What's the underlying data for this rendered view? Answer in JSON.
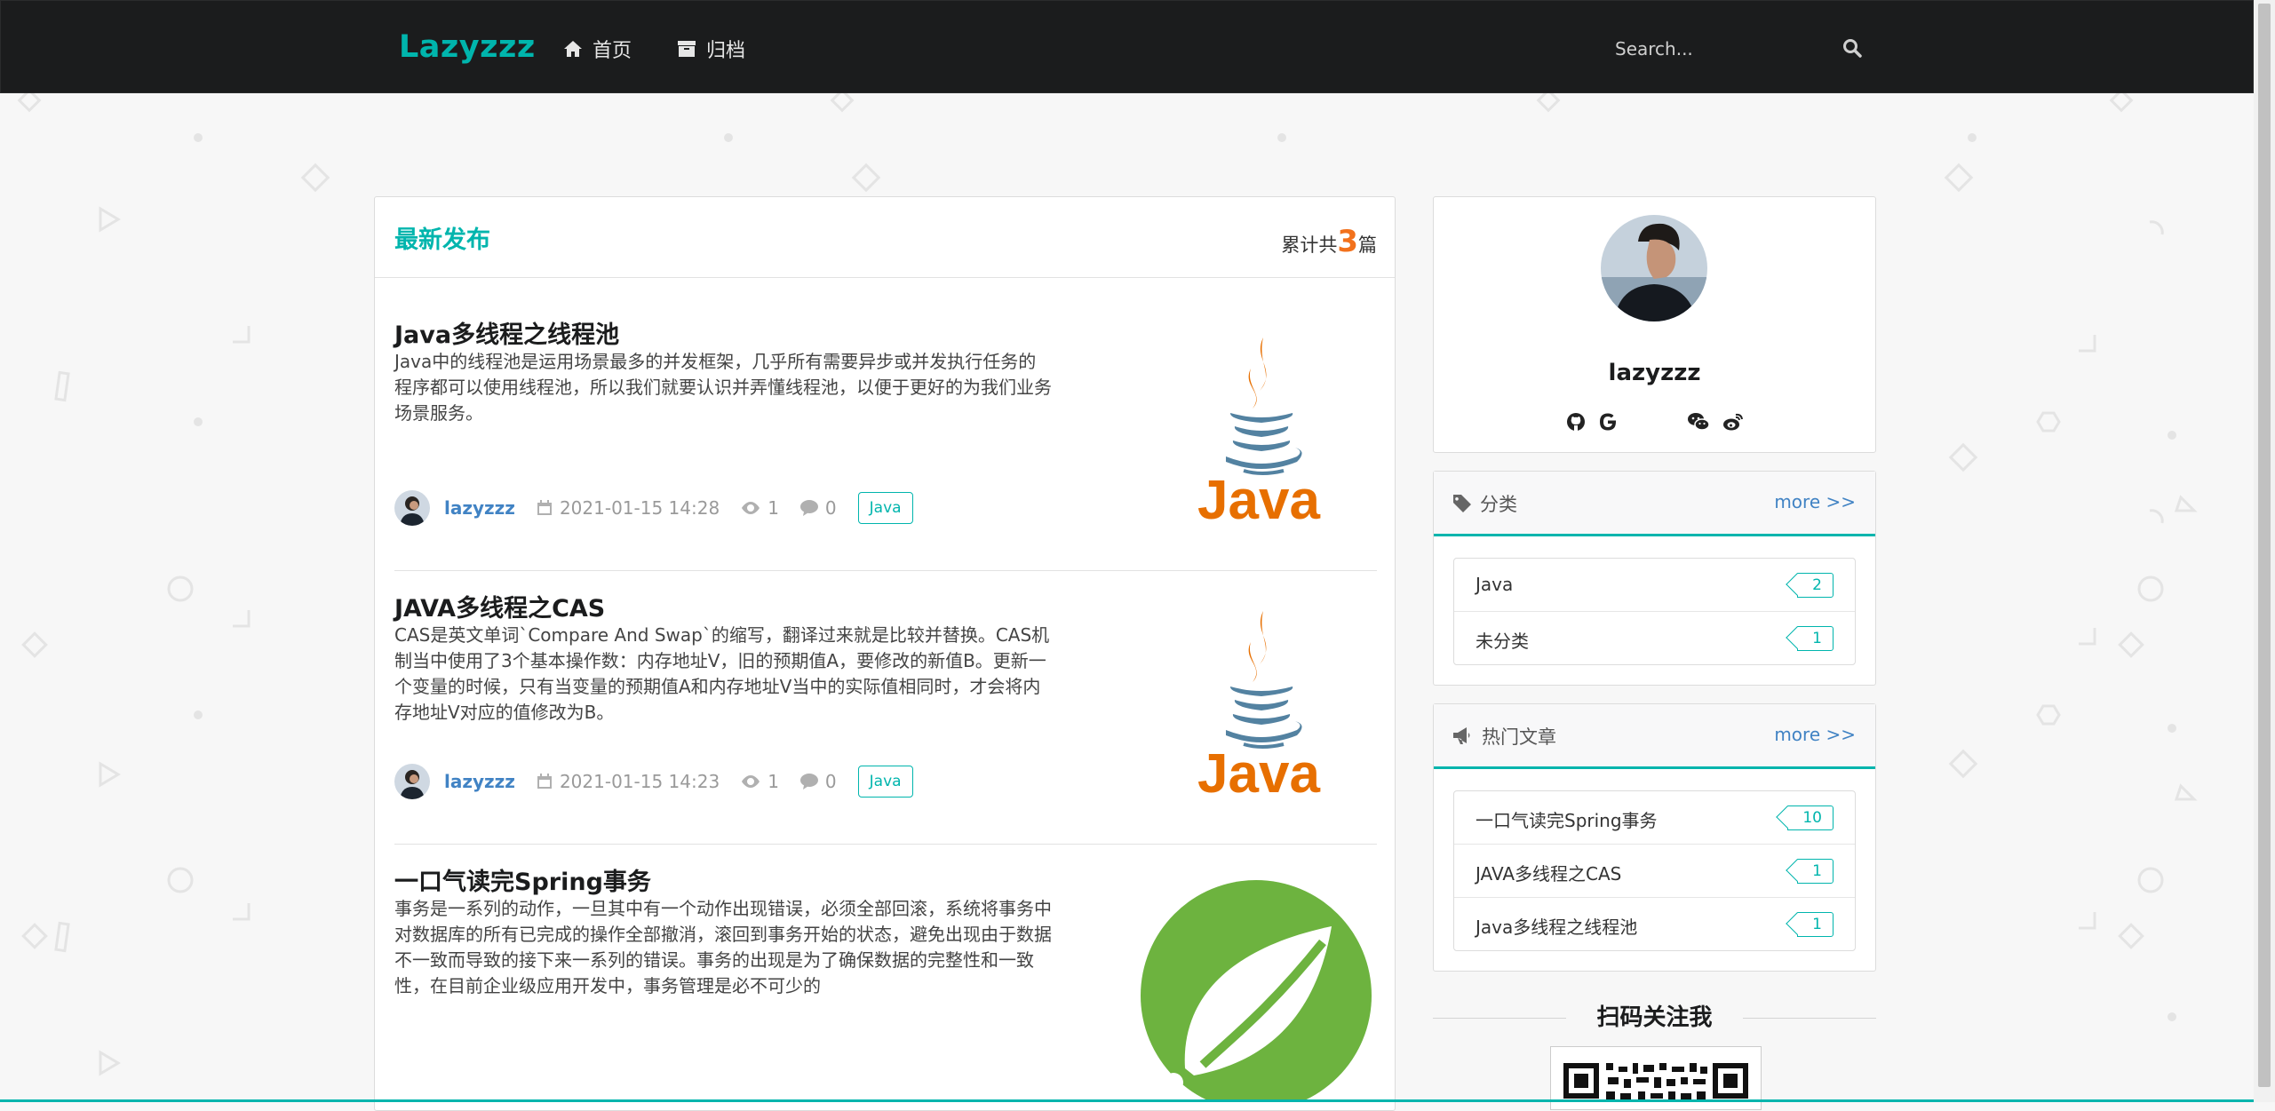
{
  "nav": {
    "brand": "Lazyzzz",
    "items": [
      {
        "label": "首页",
        "icon": "home-icon"
      },
      {
        "label": "归档",
        "icon": "archive-icon"
      }
    ],
    "search_placeholder": "Search..."
  },
  "main": {
    "title": "最新发布",
    "count_prefix": "累计共",
    "count": "3",
    "count_suffix": "篇",
    "posts": [
      {
        "title": "Java多线程之线程池",
        "excerpt": "Java中的线程池是运用场景最多的并发框架，几乎所有需要异步或并发执行任务的程序都可以使用线程池，所以我们就要认识并弄懂线程池，以便于更好的为我们业务场景服务。",
        "author": "lazyzzz",
        "date": "2021-01-15 14:28",
        "views": "1",
        "comments": "0",
        "tag": "Java",
        "image": "java-logo"
      },
      {
        "title": "JAVA多线程之CAS",
        "excerpt": "CAS是英文单词`Compare And Swap`的缩写，翻译过来就是比较并替换。CAS机制当中使用了3个基本操作数：内存地址V，旧的预期值A，要修改的新值B。更新一个变量的时候，只有当变量的预期值A和内存地址V当中的实际值相同时，才会将内存地址V对应的值修改为B。",
        "author": "lazyzzz",
        "date": "2021-01-15 14:23",
        "views": "1",
        "comments": "0",
        "tag": "Java",
        "image": "java-logo"
      },
      {
        "title": "一口气读完Spring事务",
        "excerpt": "事务是一系列的动作，一旦其中有一个动作出现错误，必须全部回滚，系统将事务中对数据库的所有已完成的操作全部撤消，滚回到事务开始的状态，避免出现由于数据不一致而导致的接下来一系列的错误。事务的出现是为了确保数据的完整性和一致性，在目前企业级应用开发中，事务管理是必不可少的",
        "image": "spring-logo"
      }
    ]
  },
  "sidebar": {
    "profile": {
      "name": "lazyzzz",
      "socials": [
        "github-icon",
        "google-icon",
        "wechat-icon",
        "weibo-icon"
      ]
    },
    "categories": {
      "title": "分类",
      "more": "more >>",
      "items": [
        {
          "label": "Java",
          "count": "2"
        },
        {
          "label": "未分类",
          "count": "1"
        }
      ]
    },
    "hot": {
      "title": "热门文章",
      "more": "more >>",
      "items": [
        {
          "label": "一口气读完Spring事务",
          "count": "10"
        },
        {
          "label": "JAVA多线程之CAS",
          "count": "1"
        },
        {
          "label": "Java多线程之线程池",
          "count": "1"
        }
      ]
    },
    "qr_title": "扫码关注我"
  },
  "colors": {
    "accent": "#00b5ad",
    "count": "#f2711c",
    "link": "#4183c4",
    "nav_bg": "#1b1c1d"
  }
}
